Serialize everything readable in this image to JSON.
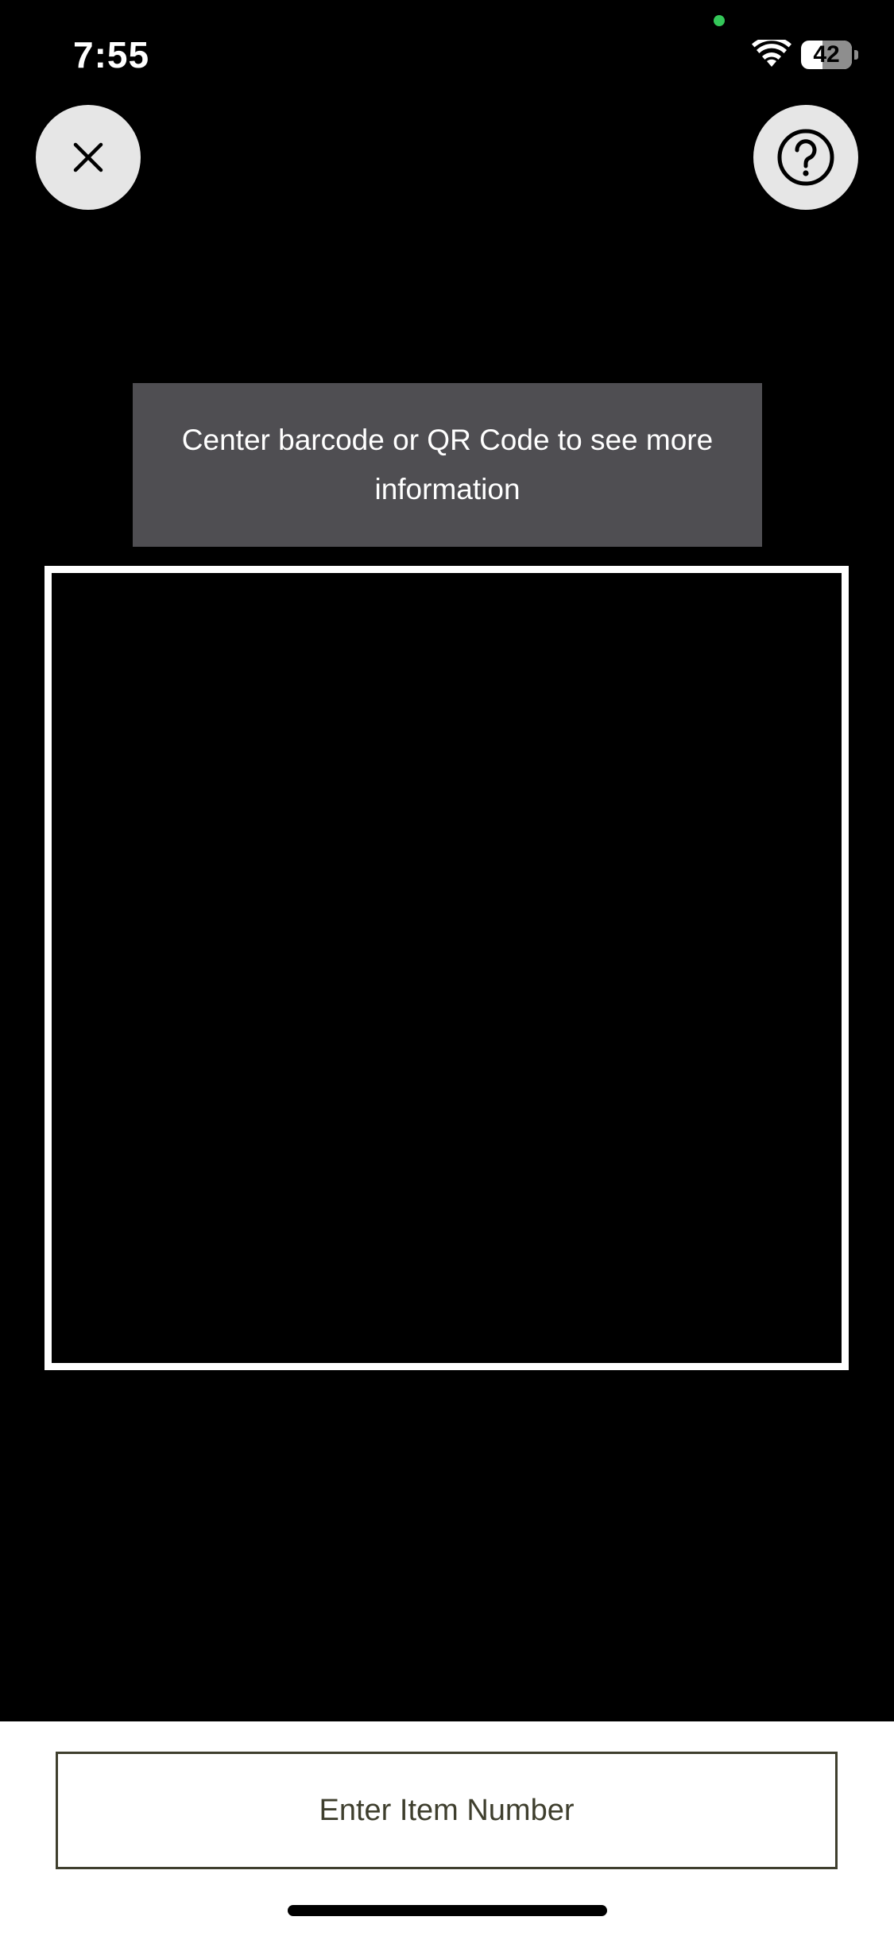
{
  "status_bar": {
    "time": "7:55",
    "battery_level": "42",
    "battery_fraction": 0.42,
    "wifi_icon": "wifi-icon",
    "privacy_indicator_color": "#34c759"
  },
  "header": {
    "close_icon": "close-icon",
    "help_icon": "question-circle-icon"
  },
  "scanner": {
    "hint_text": "Center barcode or QR Code to see more information"
  },
  "footer": {
    "enter_item_label": "Enter Item Number"
  },
  "colors": {
    "background": "#000000",
    "hint_background": "#4f4e52",
    "button_circle": "#e6e6e6",
    "frame_border": "#ffffff",
    "item_button_text": "#3f3f2e"
  }
}
